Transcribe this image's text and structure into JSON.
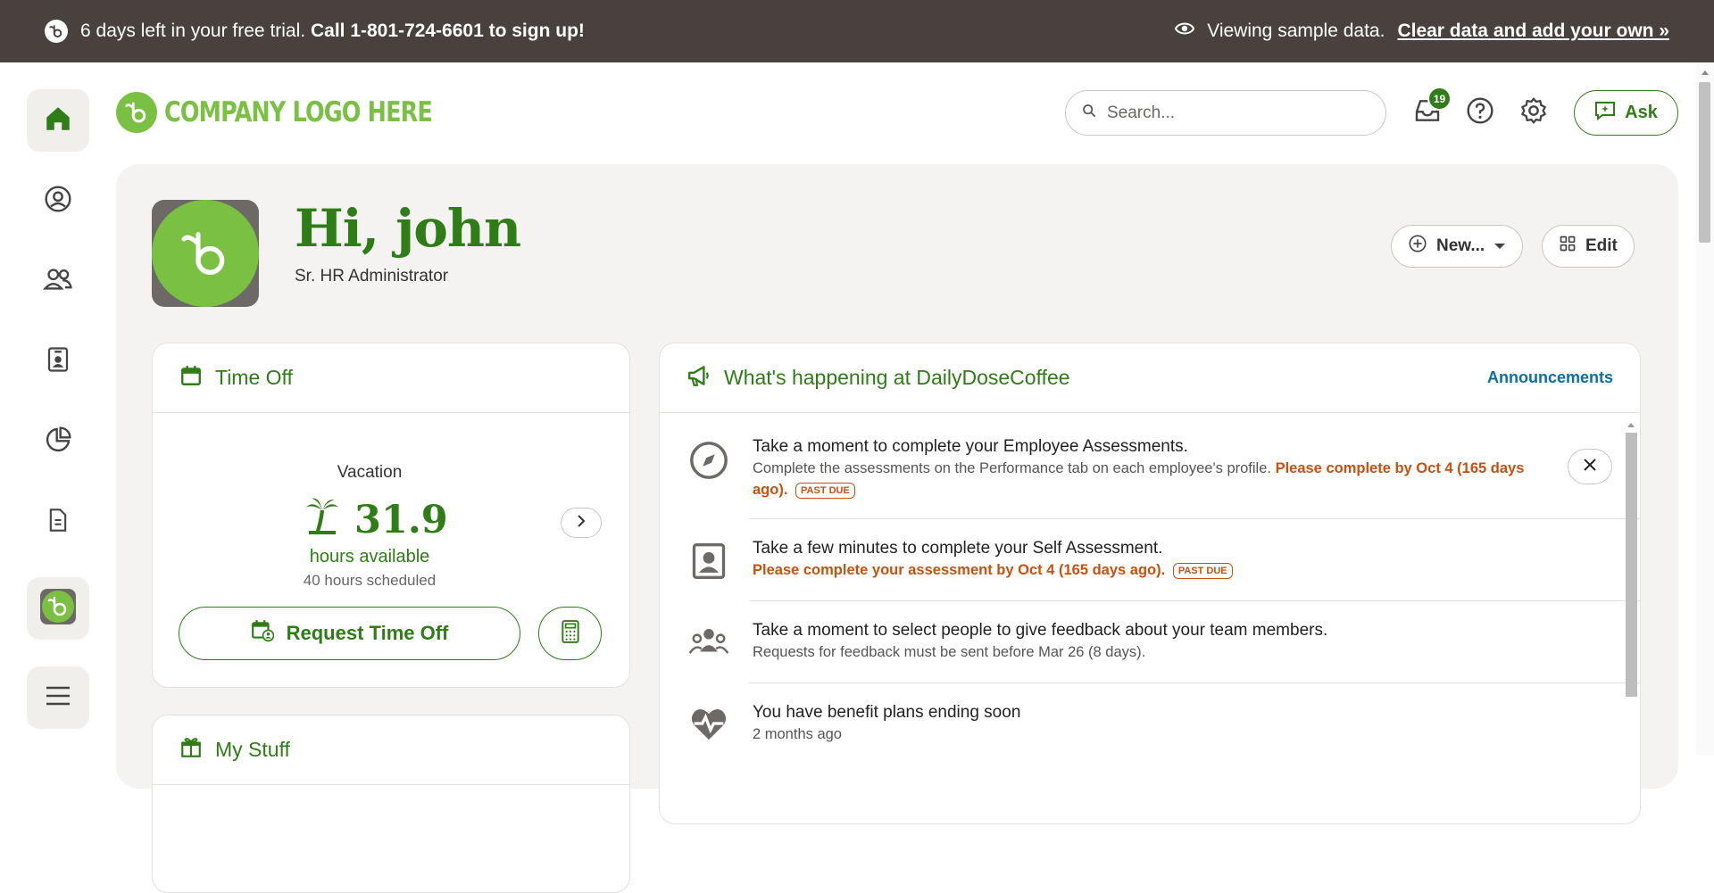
{
  "banner": {
    "trial_text": "6 days left in your free trial.",
    "call_text": "Call 1-801-724-6601 to sign up!",
    "viewing_text": "Viewing sample data.",
    "clear_link": "Clear data and add your own »"
  },
  "rail": {
    "items": [
      "home-icon",
      "profile-icon",
      "people-icon",
      "directory-icon",
      "reports-icon",
      "files-icon",
      "company-logo-icon",
      "menu-icon"
    ]
  },
  "header": {
    "logo_text": "COMPANY LOGO HERE",
    "search_placeholder": "Search...",
    "inbox_count": "19",
    "ask_label": "Ask"
  },
  "profile": {
    "greeting": "Hi, john",
    "role": "Sr. HR Administrator",
    "new_label": "New...",
    "edit_label": "Edit"
  },
  "time_off": {
    "title": "Time Off",
    "type": "Vacation",
    "amount": "31.9",
    "available_label": "hours available",
    "scheduled_label": "40 hours scheduled",
    "request_label": "Request Time Off"
  },
  "my_stuff": {
    "title": "My Stuff"
  },
  "whats_happening": {
    "title": "What's happening at DailyDoseCoffee",
    "link": "Announcements",
    "items": [
      {
        "title": "Take a moment to complete your Employee Assessments.",
        "desc": "Complete the assessments on the Performance tab on each employee's profile.",
        "alert": "Please complete by Oct 4 (165 days ago).",
        "badge": "PAST DUE"
      },
      {
        "title": "Take a few minutes to complete your Self Assessment.",
        "alert": "Please complete your assessment by Oct 4 (165 days ago).",
        "badge": "PAST DUE"
      },
      {
        "title": "Take a moment to select people to give feedback about your team members.",
        "desc": "Requests for feedback must be sent before Mar 26 (8 days)."
      },
      {
        "title": "You have benefit plans ending soon",
        "desc": "2 months ago"
      }
    ]
  },
  "colors": {
    "brand_green": "#2e7d16",
    "logo_green": "#7ac143",
    "banner_bg": "#48413e",
    "alert_orange": "#c7510f",
    "link_blue": "#0b6fa4"
  }
}
